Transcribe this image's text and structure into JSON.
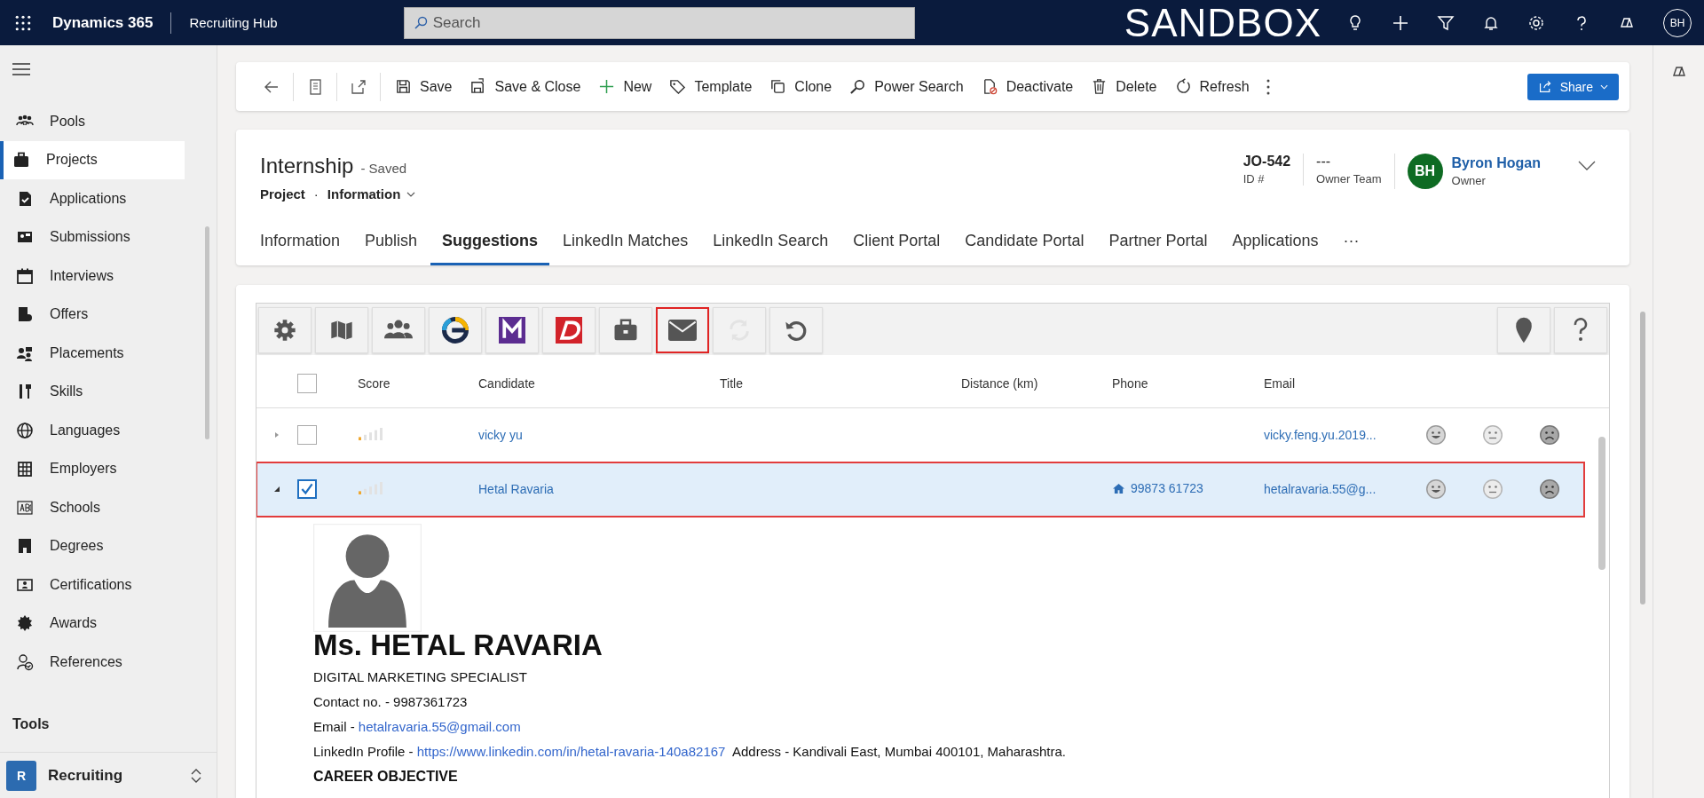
{
  "app_bar": {
    "title": "Dynamics 365",
    "area": "Recruiting Hub",
    "search": {
      "placeholder": "Search"
    },
    "environment": "SANDBOX",
    "avatar": "BH"
  },
  "sidebar": {
    "items": [
      {
        "label": "Pools",
        "selected": false
      },
      {
        "label": "Projects",
        "selected": true
      },
      {
        "label": "Applications",
        "selected": false
      },
      {
        "label": "Submissions",
        "selected": false
      },
      {
        "label": "Interviews",
        "selected": false
      },
      {
        "label": "Offers",
        "selected": false
      },
      {
        "label": "Placements",
        "selected": false
      },
      {
        "label": "Skills",
        "selected": false
      },
      {
        "label": "Languages",
        "selected": false
      },
      {
        "label": "Employers",
        "selected": false
      },
      {
        "label": "Schools",
        "selected": false
      },
      {
        "label": "Degrees",
        "selected": false
      },
      {
        "label": "Certifications",
        "selected": false
      },
      {
        "label": "Awards",
        "selected": false
      },
      {
        "label": "References",
        "selected": false
      }
    ],
    "section": "Tools",
    "area_switcher": {
      "badge": "R",
      "label": "Recruiting"
    }
  },
  "command_bar": {
    "buttons": [
      "Save",
      "Save & Close",
      "New",
      "Template",
      "Clone",
      "Power Search",
      "Deactivate",
      "Delete",
      "Refresh"
    ],
    "share": "Share"
  },
  "record": {
    "title": "Internship",
    "status": "- Saved",
    "entity": "Project",
    "separator": "·",
    "form": "Information",
    "id": {
      "value": "JO-542",
      "label": "ID #"
    },
    "owner_team": {
      "value": "---",
      "label": "Owner Team"
    },
    "owner": {
      "initials": "BH",
      "name": "Byron Hogan",
      "label": "Owner"
    },
    "tabs": [
      {
        "label": "Information",
        "selected": false
      },
      {
        "label": "Publish",
        "selected": false
      },
      {
        "label": "Suggestions",
        "selected": true
      },
      {
        "label": "LinkedIn Matches",
        "selected": false
      },
      {
        "label": "LinkedIn Search",
        "selected": false
      },
      {
        "label": "Client Portal",
        "selected": false
      },
      {
        "label": "Candidate Portal",
        "selected": false
      },
      {
        "label": "Partner Portal",
        "selected": false
      },
      {
        "label": "Applications",
        "selected": false
      }
    ],
    "more": "···"
  },
  "suggestions": {
    "tools": [
      {
        "kind": "settings",
        "highlighted": false,
        "disabled": false
      },
      {
        "kind": "map",
        "highlighted": false,
        "disabled": false
      },
      {
        "kind": "people",
        "highlighted": false,
        "disabled": false
      },
      {
        "kind": "ring",
        "highlighted": false,
        "disabled": false
      },
      {
        "kind": "m-logo",
        "highlighted": false,
        "disabled": false
      },
      {
        "kind": "d-logo",
        "highlighted": false,
        "disabled": false
      },
      {
        "kind": "briefcase",
        "highlighted": false,
        "disabled": false
      },
      {
        "kind": "mail",
        "highlighted": true,
        "disabled": false
      },
      {
        "kind": "sync",
        "highlighted": false,
        "disabled": true
      },
      {
        "kind": "undo",
        "highlighted": false,
        "disabled": false
      }
    ],
    "right_tools": [
      {
        "kind": "pin"
      },
      {
        "kind": "help"
      }
    ],
    "select_all": {
      "checked": false
    },
    "columns": [
      "Score",
      "Candidate",
      "Title",
      "Distance (km)",
      "Phone",
      "Email"
    ],
    "rows": [
      {
        "expanded": false,
        "checked": false,
        "selected": false,
        "level": 0.2,
        "candidate": "vicky yu",
        "email": "vicky.feng.yu.2019..."
      },
      {
        "expanded": true,
        "checked": true,
        "selected": true,
        "level": 0.2,
        "candidate": "Hetal Ravaria",
        "phone": "99873 61723",
        "email": "hetalravaria.55@g..."
      }
    ],
    "resume": {
      "name": "Ms. HETAL RAVARIA",
      "headline": "DIGITAL MARKETING SPECIALIST",
      "lines": [
        {
          "kind": "text",
          "text": "Contact no. - 9987361723"
        },
        {
          "kind": "link",
          "prefix": "Email - ",
          "link": "hetalravaria.55@gmail.com"
        },
        {
          "kind": "link",
          "prefix": "LinkedIn Profile - ",
          "link": "https://www.linkedin.com/in/hetal-ravaria-140a82167",
          "suffix": "Address - Kandivali East, Mumbai 400101, Maharashtra."
        },
        {
          "kind": "heading",
          "text": "CAREER OBJECTIVE"
        }
      ]
    }
  }
}
